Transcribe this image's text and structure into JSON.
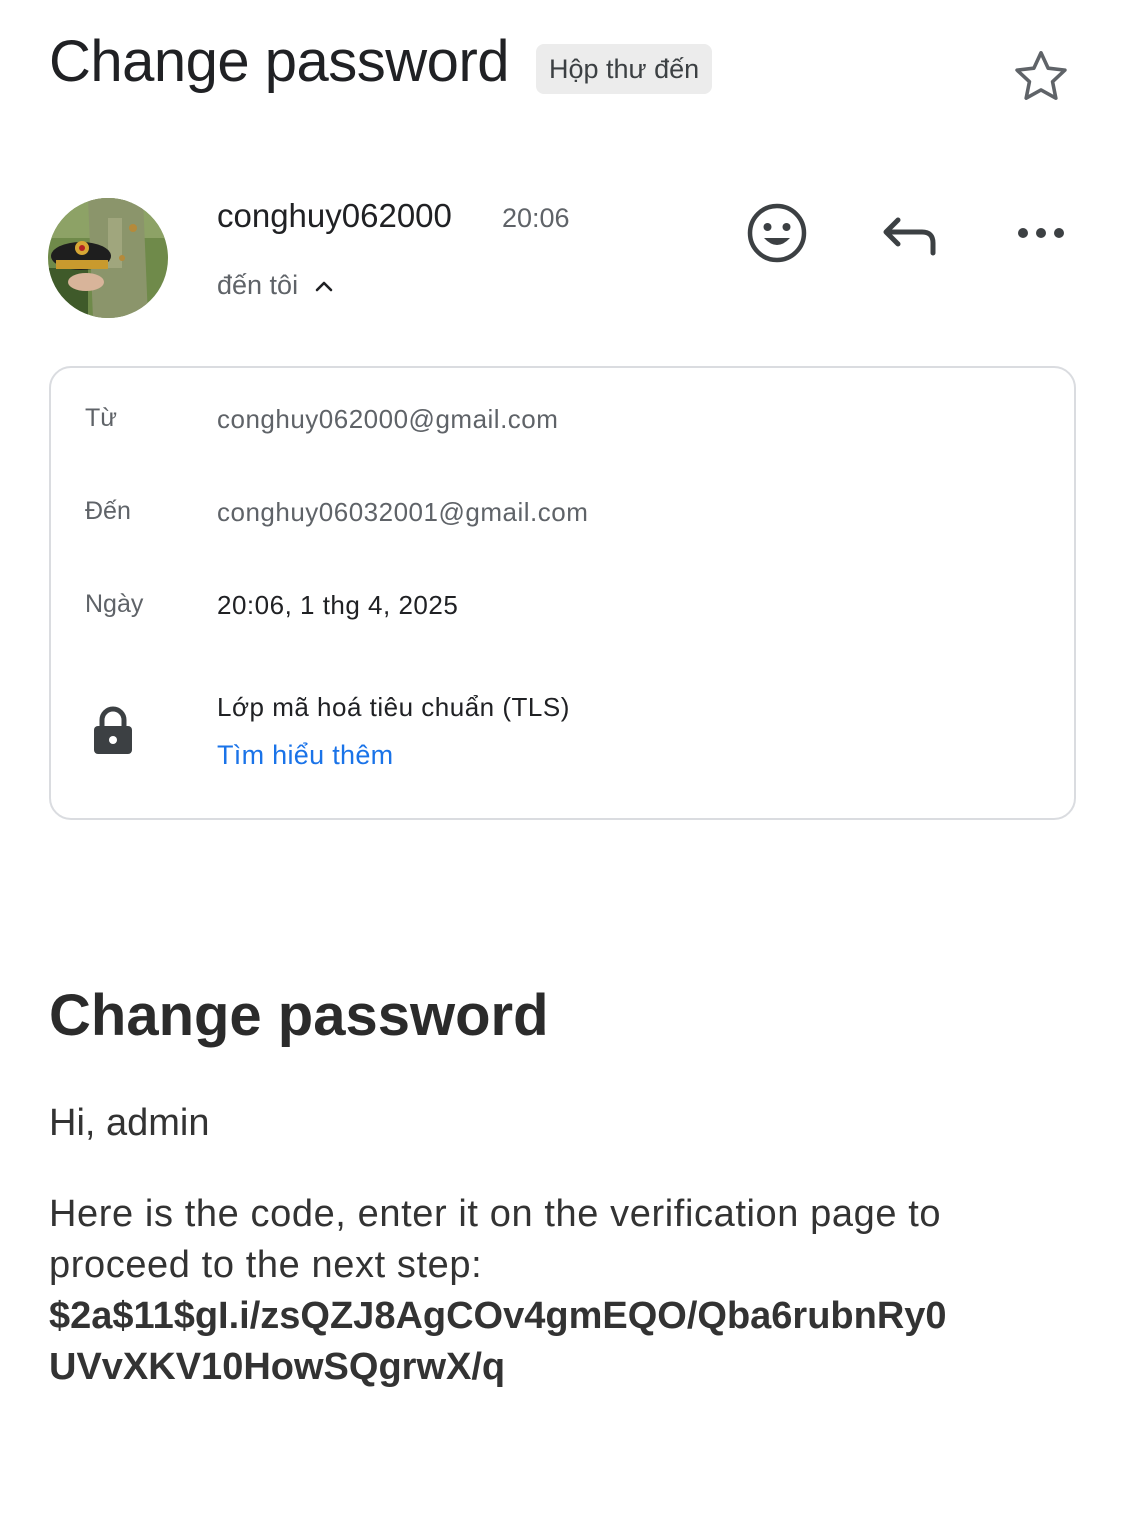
{
  "header": {
    "subject": "Change password",
    "label": "Hộp thư đến",
    "star_icon": "star-outline-icon"
  },
  "sender": {
    "name": "conghuy062000",
    "time": "20:06",
    "recipient_summary": "đến tôi"
  },
  "actions": {
    "emoji_icon": "emoji-reaction-icon",
    "reply_icon": "reply-icon",
    "more_icon": "more-horizontal-icon"
  },
  "details": {
    "from_label": "Từ",
    "from_value": "conghuy062000@gmail.com",
    "to_label": "Đến",
    "to_value": "conghuy06032001@gmail.com",
    "date_label": "Ngày",
    "date_value": "20:06, 1 thg 4, 2025",
    "security_text": "Lớp mã hoá tiêu chuẩn (TLS)",
    "learn_more": "Tìm hiểu thêm"
  },
  "body": {
    "title": "Change password",
    "greeting": "Hi, admin",
    "instruction": "Here is the code, enter it on the verification page to proceed to the next step:",
    "code": "$2a$11$gI.i/zsQZJ8AgCOv4gmEQO/Qba6rubnRy0UVvXKV10HowSQgrwX/q"
  },
  "colors": {
    "link": "#1a73e8",
    "chip_bg": "#ececec",
    "border": "#dadce0"
  }
}
